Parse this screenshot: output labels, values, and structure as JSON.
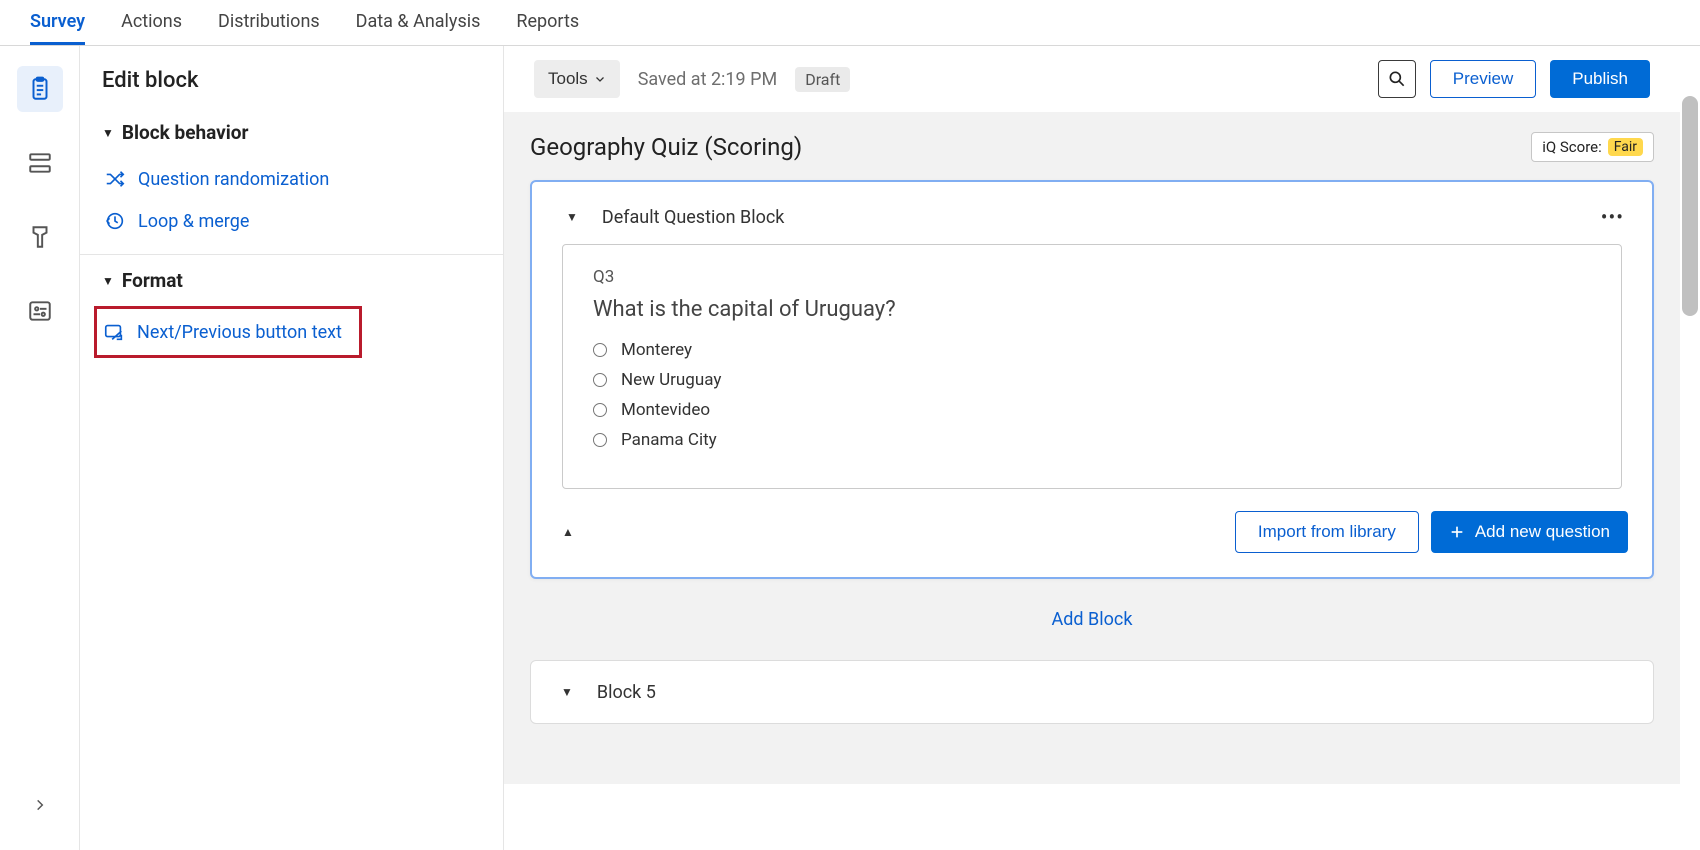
{
  "topTabs": [
    "Survey",
    "Actions",
    "Distributions",
    "Data & Analysis",
    "Reports"
  ],
  "activeTopTab": 0,
  "leftPanel": {
    "title": "Edit block",
    "sections": {
      "behavior": {
        "title": "Block behavior",
        "items": {
          "randomization": "Question randomization",
          "loopMerge": "Loop & merge"
        }
      },
      "format": {
        "title": "Format",
        "items": {
          "navButtons": "Next/Previous button text"
        }
      }
    }
  },
  "toolbar": {
    "tools": "Tools",
    "savedText": "Saved at 2:19 PM",
    "draft": "Draft",
    "preview": "Preview",
    "publish": "Publish"
  },
  "canvas": {
    "title": "Geography Quiz (Scoring)",
    "iqLabel": "iQ Score:",
    "iqValue": "Fair",
    "block": {
      "name": "Default Question Block",
      "question": {
        "id": "Q3",
        "text": "What is the capital of Uruguay?",
        "choices": [
          "Monterey",
          "New Uruguay",
          "Montevideo",
          "Panama City"
        ]
      },
      "importLibrary": "Import from library",
      "addQuestion": "Add new question"
    },
    "addBlock": "Add Block",
    "nextBlockName": "Block 5"
  }
}
